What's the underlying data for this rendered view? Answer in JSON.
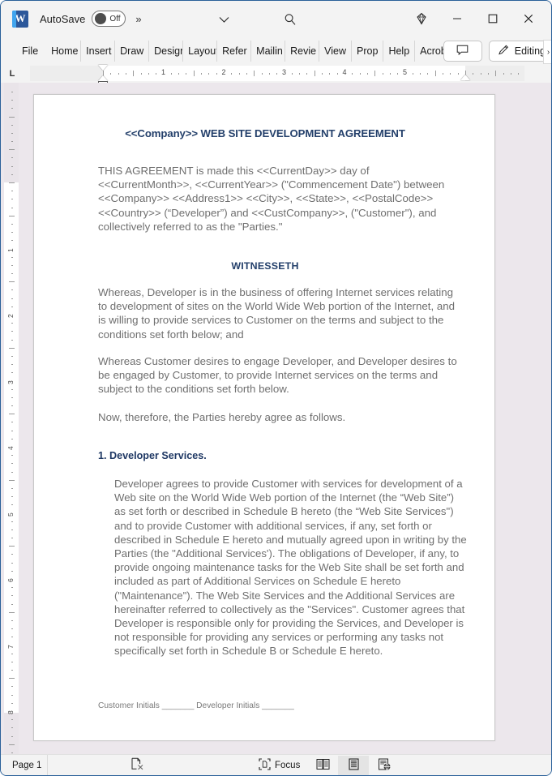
{
  "titlebar": {
    "app_icon": "word-logo",
    "autosave_label": "AutoSave",
    "autosave_state": "Off",
    "more_chevron": "»",
    "dropdown_icon": "chevron-down-icon",
    "search_icon": "search-icon",
    "copilot_icon": "diamond-icon",
    "minimize": "minimize-icon",
    "maximize": "maximize-icon",
    "close": "close-icon"
  },
  "ribbon": {
    "tabs": [
      {
        "label": "File",
        "truncated": "File"
      },
      {
        "label": "Home",
        "truncated": "Home"
      },
      {
        "label": "Insert",
        "truncated": "Insert"
      },
      {
        "label": "Draw",
        "truncated": "Draw"
      },
      {
        "label": "Design",
        "truncated": "Design"
      },
      {
        "label": "Layout",
        "truncated": "Layout"
      },
      {
        "label": "References",
        "truncated": "Refer"
      },
      {
        "label": "Mailings",
        "truncated": "Mailin"
      },
      {
        "label": "Review",
        "truncated": "Revie"
      },
      {
        "label": "View",
        "truncated": "View"
      },
      {
        "label": "Proofing",
        "truncated": "Prop"
      },
      {
        "label": "Help",
        "truncated": "Help"
      },
      {
        "label": "Acrobat",
        "truncated": "Acrob"
      }
    ],
    "comments_icon": "comment-icon",
    "editing_label": "Editing",
    "editing_icon": "pencil-icon",
    "expand_arrow": "›"
  },
  "ruler": {
    "tab_stop_marker": "L",
    "h_numbers": [
      "1",
      "2",
      "3",
      "4",
      "5"
    ],
    "v_numbers": [
      "1",
      "2",
      "3",
      "4",
      "5",
      "6",
      "7",
      "8"
    ]
  },
  "document": {
    "title": "<<Company>> WEB SITE DEVELOPMENT AGREEMENT",
    "intro_paragraph": "THIS AGREEMENT is made this <<CurrentDay>> day of <<CurrentMonth>>, <<CurrentYear>> (\"Commencement Date\") between <<Company>> <<Address1>> <<City>>, <<State>>, <<PostalCode>> <<Country>> (“Developer”) and <<CustCompany>>, (\"Customer\"), and collectively referred to as the \"Parties.\"",
    "witnesseth_heading": "WITNESSETH",
    "whereas_1": "Whereas, Developer is in the business of offering Internet services relating to development of sites on the World Wide Web portion of the Internet, and is willing to provide services to Customer on the terms and subject to the conditions set forth below; and",
    "whereas_2": "Whereas Customer desires to engage Developer, and Developer desires to be engaged by Customer, to provide Internet services on the terms and subject to the conditions set forth below.",
    "now_therefore": "Now, therefore, the Parties hereby agree as follows.",
    "section_1_heading": "1. Developer Services.",
    "section_1_body": "Developer agrees to provide Customer with services for development of a Web site on the World Wide Web portion of the Internet (the “Web Site”) as set forth or described in Schedule B hereto  (the “Web Site Services\") and to provide Customer with additional services, if any, set forth or described in Schedule E hereto and mutually agreed upon in writing by the Parties (the \"Additional Services'). The obligations of Developer, if any, to provide ongoing maintenance tasks for the Web Site shall be set forth and included as part of Additional Services on Schedule E hereto (\"Maintenance\"). The Web Site Services and the Additional Services are hereinafter referred to collectively as the \"Services\". Customer agrees that Developer is responsible only for providing the Services, and Developer is not responsible for providing any services or performing any tasks not specifically set forth in Schedule B or Schedule E hereto.",
    "footer_initials": "Customer Initials  _______ Developer Initials _______"
  },
  "statusbar": {
    "page_label": "Page 1",
    "proofing_icon": "proofing-errors-icon",
    "focus_label": "Focus",
    "focus_icon": "focus-icon",
    "view_read_icon": "read-mode-icon",
    "view_print_icon": "print-layout-icon",
    "view_web_icon": "web-layout-icon",
    "active_view": "print-layout"
  },
  "colors": {
    "accent_blue": "#2b579a",
    "heading_navy": "#24406b",
    "body_gray": "#6f6f6f",
    "page_bg": "#ece7ec",
    "chrome_bg": "#f3f3f3"
  }
}
